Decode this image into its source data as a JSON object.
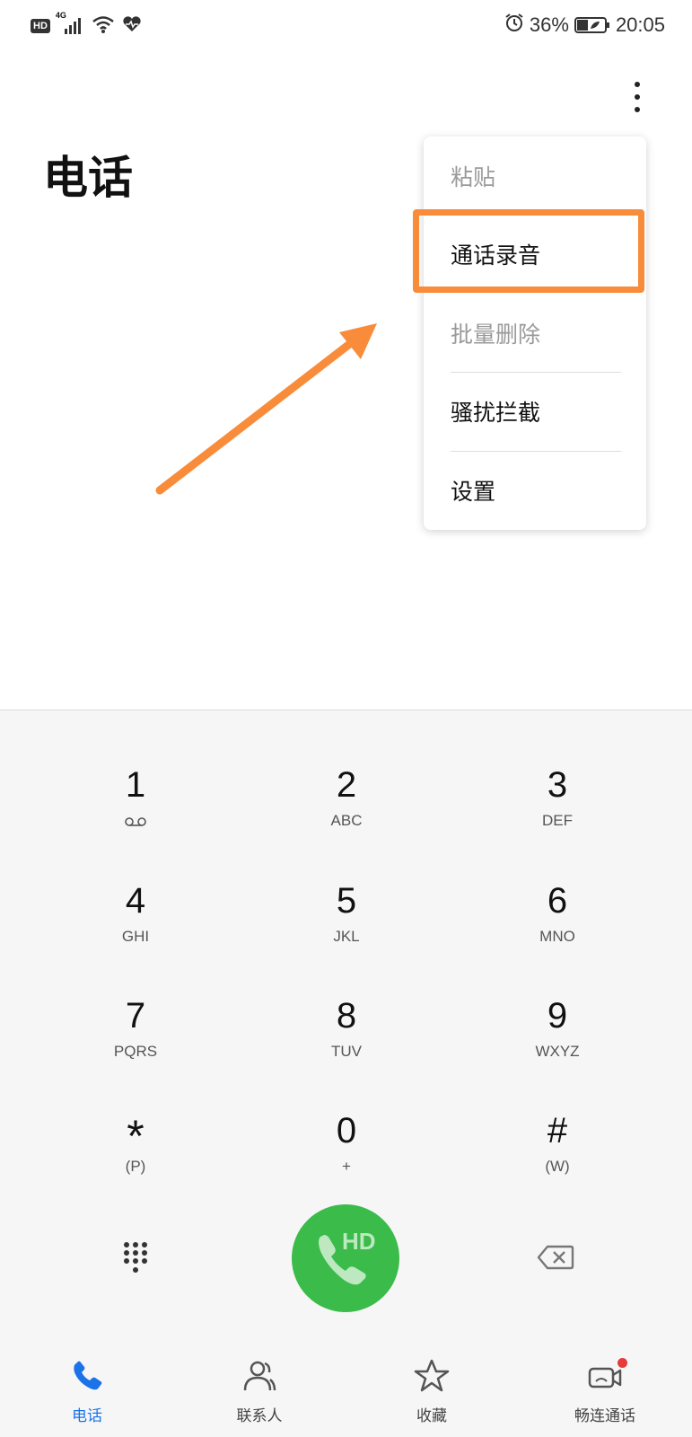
{
  "status_bar": {
    "left_badge": "HD",
    "network": "4G",
    "battery": "36%",
    "time": "20:05",
    "icons": [
      "hd-icon",
      "signal-icon",
      "wifi-icon",
      "health-icon",
      "alarm-icon",
      "battery-icon"
    ]
  },
  "header": {
    "title": "电话"
  },
  "menu": {
    "items": [
      {
        "label": "粘贴",
        "enabled": false
      },
      {
        "label": "通话录音",
        "enabled": true,
        "highlighted": true
      },
      {
        "label": "批量删除",
        "enabled": false
      },
      {
        "label": "骚扰拦截",
        "enabled": true
      },
      {
        "label": "设置",
        "enabled": true
      }
    ]
  },
  "dialpad": {
    "keys": [
      {
        "digit": "1",
        "letters": ""
      },
      {
        "digit": "2",
        "letters": "ABC"
      },
      {
        "digit": "3",
        "letters": "DEF"
      },
      {
        "digit": "4",
        "letters": "GHI"
      },
      {
        "digit": "5",
        "letters": "JKL"
      },
      {
        "digit": "6",
        "letters": "MNO"
      },
      {
        "digit": "7",
        "letters": "PQRS"
      },
      {
        "digit": "8",
        "letters": "TUV"
      },
      {
        "digit": "9",
        "letters": "WXYZ"
      },
      {
        "digit": "*",
        "letters": "(P)"
      },
      {
        "digit": "0",
        "letters": "+"
      },
      {
        "digit": "#",
        "letters": "(W)"
      }
    ],
    "call_badge": "HD"
  },
  "bottom_nav": {
    "items": [
      {
        "label": "电话",
        "icon": "phone-icon",
        "active": true
      },
      {
        "label": "联系人",
        "icon": "contacts-icon",
        "active": false
      },
      {
        "label": "收藏",
        "icon": "star-icon",
        "active": false
      },
      {
        "label": "畅连通话",
        "icon": "video-call-icon",
        "active": false
      }
    ]
  },
  "colors": {
    "accent": "#1a73e8",
    "call_green": "#3bbb4a",
    "annotation_orange": "#f98c3a",
    "notification_red": "#e83a3a"
  }
}
